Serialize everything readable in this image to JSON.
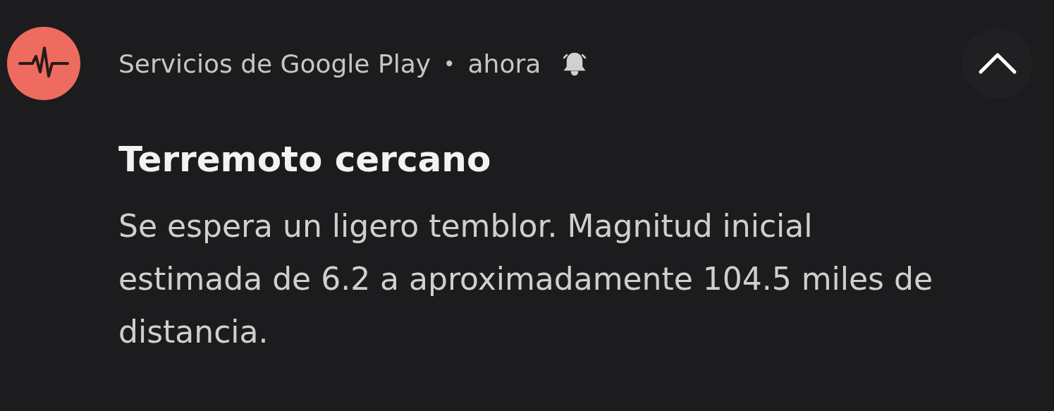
{
  "notification": {
    "app": "Servicios de Google Play",
    "separator": "•",
    "time": "ahora",
    "expanded": true,
    "title": "Terremoto cercano",
    "body": "Se espera un ligero temblor. Magnitud inicial estimada de 6.2 a aproximadamente 104.5 miles de distancia."
  }
}
